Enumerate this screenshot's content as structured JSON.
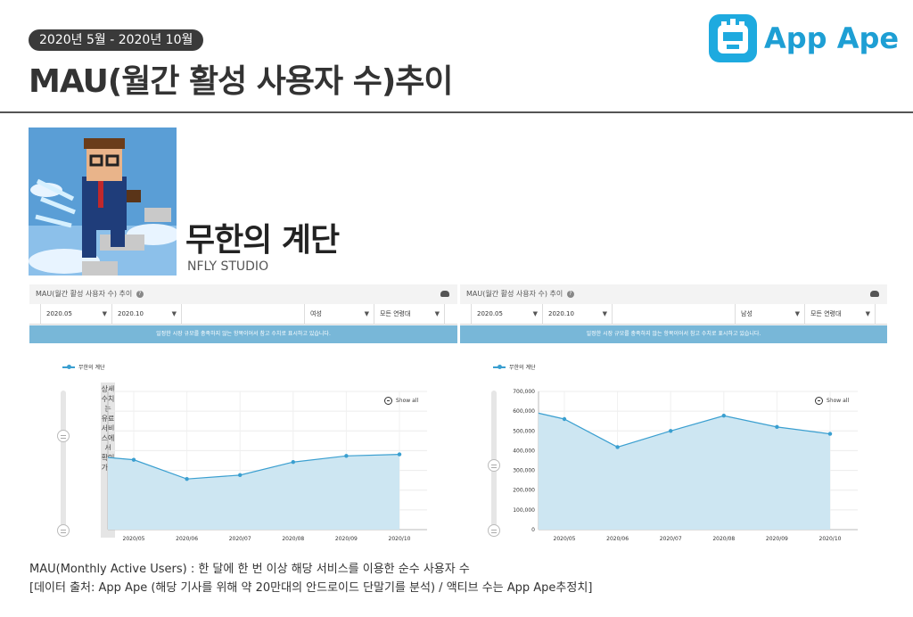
{
  "period": "2020년 5월 - 2020년 10월",
  "title": "MAU(월간 활성 사용자 수)추이",
  "brand": "App Ape",
  "app": {
    "name": "무한의 계단",
    "developer": "NFLY STUDIO"
  },
  "colors": {
    "accent": "#1e9fd4",
    "line": "#3a9fd0",
    "fill": "#cde6f2",
    "banner": "#78b7d8"
  },
  "panels": [
    {
      "header": "MAU(월간 활성 사용자 수) 추이",
      "filters": {
        "start": "2020.05",
        "end": "2020.10",
        "gender": "여성",
        "age": "모든 연령대"
      },
      "notice": "일정한 시장 규모를 충족하지 않는 항목이어서 참고 수치로 표시하고 있습니다.",
      "restricted_note": "상세수치는 유료서비스에서 확인가능",
      "show_all": "Show all"
    },
    {
      "header": "MAU(월간 활성 사용자 수) 추이",
      "filters": {
        "start": "2020.05",
        "end": "2020.10",
        "gender": "남성",
        "age": "모든 연령대"
      },
      "notice": "일정한 시장 규모를 충족하지 않는 항목이어서 참고 수치로 표시하고 있습니다.",
      "show_all": "Show all"
    }
  ],
  "chart_data": [
    {
      "type": "area",
      "categories": [
        "2020/05",
        "2020/06",
        "2020/07",
        "2020/08",
        "2020/09",
        "2020/10"
      ],
      "series": [
        {
          "name": "무한의 계단",
          "values": [
            455000,
            330000,
            355000,
            440000,
            480000,
            490000
          ]
        }
      ],
      "ylim": [
        0,
        900000
      ],
      "start_value": 470000,
      "yticks": [],
      "grid": true,
      "legend": "top-left"
    },
    {
      "type": "area",
      "categories": [
        "2020/05",
        "2020/06",
        "2020/07",
        "2020/08",
        "2020/09",
        "2020/10"
      ],
      "series": [
        {
          "name": "무한의 계단",
          "values": [
            560000,
            418000,
            500000,
            577000,
            520000,
            485000
          ]
        }
      ],
      "ylim": [
        0,
        700000
      ],
      "start_value": 590000,
      "yticks": [
        "0",
        "100,000",
        "200,000",
        "300,000",
        "400,000",
        "500,000",
        "600,000",
        "700,000"
      ],
      "grid": true,
      "legend": "top-left"
    }
  ],
  "footnotes": [
    "MAU(Monthly Active Users) : 한 달에 한 번 이상 해당 서비스를 이용한 순수 사용자 수",
    "[데이터 출처: App Ape (해당 기사를 위해 약 20만대의 안드로이드 단말기를 분석) / 액티브 수는 App Ape추정치]"
  ]
}
